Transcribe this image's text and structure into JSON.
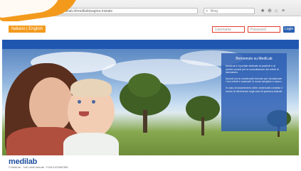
{
  "browser": {
    "url": "http://medilab.it/medilab/pagina-iniziale",
    "search_placeholder": "Bing",
    "tools": [
      "★",
      "⊕",
      "⌂",
      "≡"
    ]
  },
  "header": {
    "language": "Italiano | English",
    "login": {
      "username_placeholder": "Username",
      "password_placeholder": "Password",
      "button": "Login"
    }
  },
  "hero": {
    "panel": {
      "title": "Benvenuto su MediLab",
      "paragraphs": [
        "MediLab è il portale dedicato ai pazienti e ai medici curanti per la consultazione dei referti di laboratorio.",
        "Accedi con le credenziali ricevute per visualizzare i tuoi referti e scaricarli in modo semplice e sicuro.",
        "In caso di smarrimento delle credenziali contatta il centro di riferimento negli orari di apertura indicati."
      ]
    }
  },
  "footer": {
    "logo": "medilab",
    "copyright": "© MediLab - Tutti i diritti riservati - P.IVA 01234567890"
  },
  "colors": {
    "accent": "#f39a1d",
    "brand_blue": "#1f56b0",
    "highlight": "#e23b2a"
  }
}
